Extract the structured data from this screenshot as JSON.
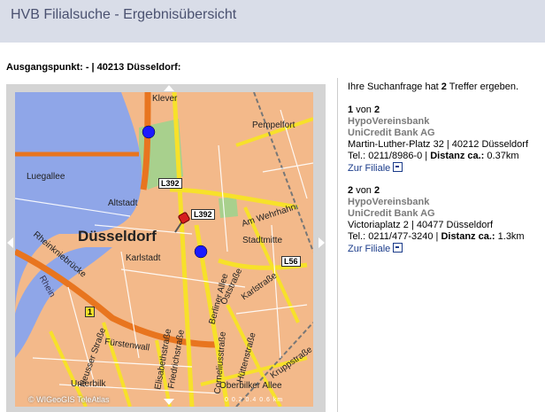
{
  "header": {
    "title": "HVB Filialsuche - Ergebnisübersicht"
  },
  "origin": {
    "label": "Ausgangspunkt: - | 40213 Düsseldorf:"
  },
  "map": {
    "copyright": "© WIGeoGIS TeleAtlas",
    "scale": "0  0.2 0.4  0.6 km",
    "labels": {
      "city": "Düsseldorf",
      "kleve": "Klever",
      "pempelfort": "Pempelfort",
      "luegallee": "Luegallee",
      "altstadt": "Altstadt",
      "l392a": "L392",
      "l392b": "L392",
      "wehrhahn": "Am Wehrhahn",
      "stadtmitte": "Stadtmitte",
      "karlstadt": "Karlstadt",
      "l56": "L56",
      "rheinknie": "Rheinkniebrücke",
      "rhein": "Rhein",
      "berliner": "Berliner Allee",
      "oststr": "Oststraße",
      "karlstr": "Karlstraße",
      "fuerstenwall": "Fürstenwall",
      "neusser": "Neusser Straße",
      "elisabeth": "Elisabethstraße",
      "friedrich": "Friedrichstraße",
      "hutten": "Hüttenstraße",
      "corneli": "Corneliusstraße",
      "oberbilker": "Oberbilker Allee",
      "unterbilk": "Unterbilk",
      "kruppstr": "Kruppstraße",
      "b1": "1"
    }
  },
  "results": {
    "intro_prefix": "Ihre Suchanfrage hat ",
    "count": "2",
    "intro_suffix": " Treffer ergeben.",
    "entries": [
      {
        "index": "1",
        "of_label": "von",
        "total": "2",
        "name": "HypoVereinsbank",
        "bank": "UniCredit Bank AG",
        "address": "Martin-Luther-Platz 32 | 40212 Düsseldorf",
        "tel_label": "Tel.:",
        "tel": "0211/8986-0",
        "dist_label": "Distanz ca.:",
        "dist": "0.37km",
        "link": "Zur Filiale"
      },
      {
        "index": "2",
        "of_label": "von",
        "total": "2",
        "name": "HypoVereinsbank",
        "bank": "UniCredit Bank AG",
        "address": "Victoriaplatz 2 | 40477 Düsseldorf",
        "tel_label": "Tel.:",
        "tel": "0211/477-3240",
        "dist_label": "Distanz ca.:",
        "dist": "1.3km",
        "link": "Zur Filiale"
      }
    ]
  },
  "colors": {
    "header_bg": "#d9dde8",
    "river": "#8fa6e8",
    "road": "#f7e12a",
    "main_road": "#e8751f",
    "marker": "#1a1aff"
  }
}
